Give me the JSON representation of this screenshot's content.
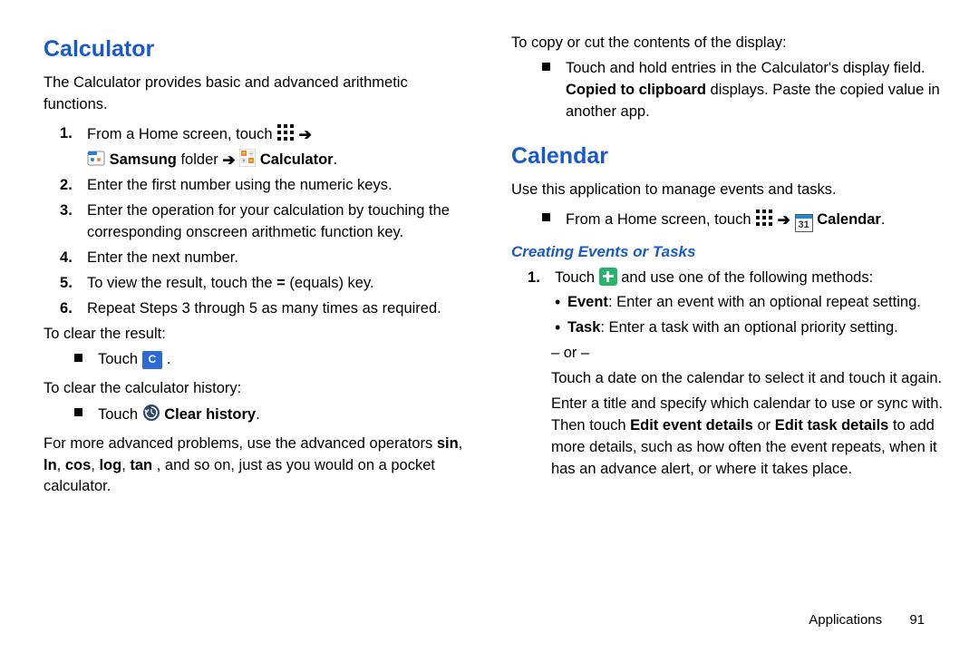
{
  "left": {
    "heading": "Calculator",
    "intro": "The Calculator provides basic and advanced arithmetic functions.",
    "step1_a": "From a Home screen, touch ",
    "step1_folder_label": "Samsung",
    "step1_folder_suffix": " folder ",
    "step1_calc_label": "Calculator",
    "step1_end": ".",
    "step2": "Enter the first number using the numeric keys.",
    "step3": "Enter the operation for your calculation by touching the corresponding onscreen arithmetic function key.",
    "step4": "Enter the next number.",
    "step5_a": "To view the result, touch the ",
    "step5_eq": "=",
    "step5_b": " (equals) key.",
    "step6": "Repeat Steps 3 through 5 as many times as required.",
    "clear_result_label": "To clear the result:",
    "clear_result_item_a": "Touch ",
    "c_btn": "C",
    "clear_result_item_b": " .",
    "clear_history_label": "To clear the calculator history:",
    "clear_history_item_a": "Touch ",
    "clear_history_bold": "Clear history",
    "clear_history_item_b": ".",
    "advanced_a": "For more advanced problems, use the advanced operators ",
    "advanced_ops": "sin",
    "advanced_sep1": ", ",
    "advanced_op2": "ln",
    "advanced_sep2": ", ",
    "advanced_op3": "cos",
    "advanced_sep3": ", ",
    "advanced_op4": "log",
    "advanced_sep4": ", ",
    "advanced_op5": "tan",
    "advanced_b": ", and so on, just as you would on a pocket calculator."
  },
  "right": {
    "copy_label": "To copy or cut the contents of the display:",
    "copy_item_a": "Touch and hold entries in the Calculator's display field. ",
    "copy_bold": "Copied to clipboard",
    "copy_item_b": " displays. Paste the copied value in another app.",
    "heading": "Calendar",
    "intro": "Use this application to manage events and tasks.",
    "hom_a": "From a Home screen, touch ",
    "cal_label": "Calendar",
    "cal_31": "31",
    "hom_end": ".",
    "subheading": "Creating Events or Tasks",
    "step1_a": "Touch ",
    "step1_b": " and use one of the following methods:",
    "event_bold": "Event",
    "event_text": ": Enter an event with an optional repeat setting.",
    "task_bold": "Task",
    "task_text": ": Enter a task with an optional priority setting.",
    "or_label": "– or –",
    "or_text": "Touch a date on the calendar to select it and touch it again.",
    "follow_a": "Enter a title and specify which calendar to use or sync with. Then touch ",
    "follow_b1": "Edit event details",
    "follow_mid": " or ",
    "follow_b2": "Edit task details",
    "follow_c": " to add more details, such as how often the event repeats, when it has an advance alert, or where it takes place."
  },
  "footer": {
    "section": "Applications",
    "page": "91"
  }
}
